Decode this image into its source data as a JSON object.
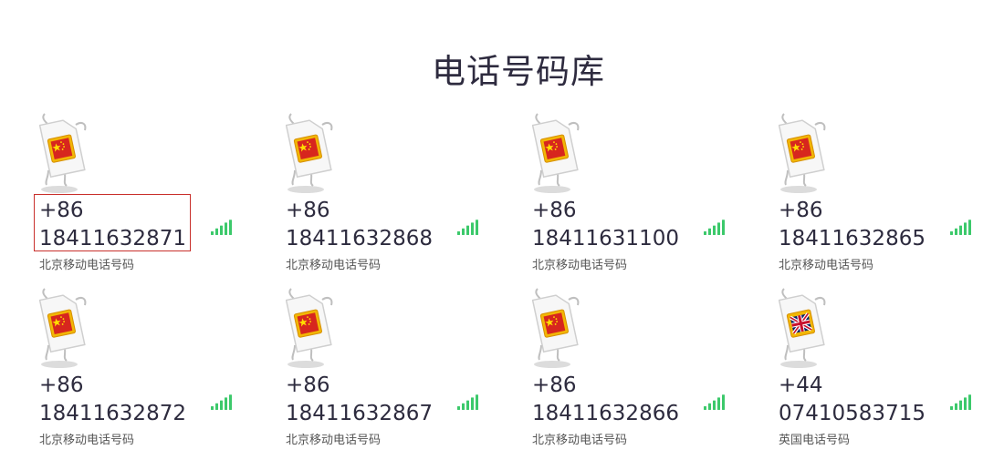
{
  "page": {
    "title": "电话号码库"
  },
  "numbers": [
    {
      "country_code": "+86",
      "number": "18411632871",
      "label": "北京移动电话号码",
      "flag": "china-flag-icon",
      "selected": true
    },
    {
      "country_code": "+86",
      "number": "18411632868",
      "label": "北京移动电话号码",
      "flag": "china-flag-icon",
      "selected": false
    },
    {
      "country_code": "+86",
      "number": "18411631100",
      "label": "北京移动电话号码",
      "flag": "china-flag-icon",
      "selected": false
    },
    {
      "country_code": "+86",
      "number": "18411632865",
      "label": "北京移动电话号码",
      "flag": "china-flag-icon",
      "selected": false
    },
    {
      "country_code": "+86",
      "number": "18411632872",
      "label": "北京移动电话号码",
      "flag": "china-flag-icon",
      "selected": false
    },
    {
      "country_code": "+86",
      "number": "18411632867",
      "label": "北京移动电话号码",
      "flag": "china-flag-icon",
      "selected": false
    },
    {
      "country_code": "+86",
      "number": "18411632866",
      "label": "北京移动电话号码",
      "flag": "china-flag-icon",
      "selected": false
    },
    {
      "country_code": "+44",
      "number": "07410583715",
      "label": "英国电话号码",
      "flag": "uk-flag-icon",
      "selected": false
    }
  ],
  "colors": {
    "signal": "#3cc96b",
    "selection_border": "#c9302c",
    "title": "#2e2b3f"
  }
}
